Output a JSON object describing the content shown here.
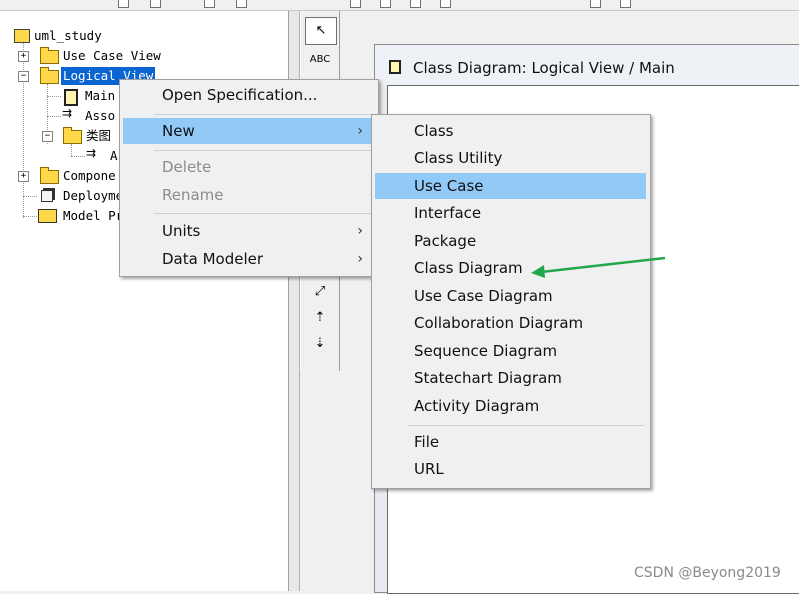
{
  "tree": {
    "root": "uml_study",
    "nodes": [
      {
        "label": "Use Case View"
      },
      {
        "label": "Logical View"
      },
      {
        "label": "Main"
      },
      {
        "label": "Asso"
      },
      {
        "label": "类图"
      },
      {
        "label": "A"
      },
      {
        "label": "Compone"
      },
      {
        "label": "Deployme"
      },
      {
        "label": "Model Pr"
      }
    ]
  },
  "toolbox": {
    "pointer_glyph": "↖",
    "text_tool": "ABC"
  },
  "diagram_window": {
    "title": "Class Diagram: Logical View / Main"
  },
  "context_menu": {
    "items": [
      {
        "label": "Open Specification...",
        "disabled": false
      },
      {
        "label": "New",
        "highlighted": true,
        "submenu": true
      },
      {
        "label": "Delete",
        "disabled": true
      },
      {
        "label": "Rename",
        "disabled": true
      },
      {
        "label": "Units",
        "submenu": true
      },
      {
        "label": "Data Modeler",
        "submenu": true
      }
    ]
  },
  "new_submenu": {
    "items": [
      {
        "label": "Class"
      },
      {
        "label": "Class Utility"
      },
      {
        "label": "Use Case",
        "highlighted": true
      },
      {
        "label": "Interface"
      },
      {
        "label": "Package"
      },
      {
        "label": "Class Diagram",
        "annotated": true
      },
      {
        "label": "Use Case Diagram"
      },
      {
        "label": "Collaboration Diagram"
      },
      {
        "label": "Sequence Diagram"
      },
      {
        "label": "Statechart Diagram"
      },
      {
        "label": "Activity Diagram"
      },
      {
        "label": "File"
      },
      {
        "label": "URL"
      }
    ]
  },
  "annotation": {
    "arrow_color": "#22a84a"
  },
  "watermark": "CSDN @Beyong2019",
  "colors": {
    "selection_blue": "#0a64d2",
    "menu_highlight": "#91c9f7",
    "menu_bg": "#f0f0f0"
  }
}
